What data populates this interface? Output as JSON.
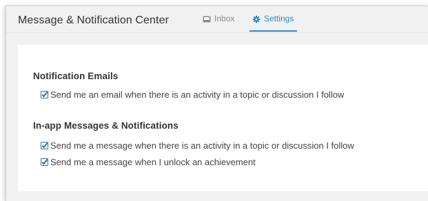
{
  "header": {
    "title": "Message & Notification Center",
    "tabs": [
      {
        "label": "Inbox",
        "icon": "inbox-icon",
        "active": false
      },
      {
        "label": "Settings",
        "icon": "gear-icon",
        "active": true
      }
    ]
  },
  "settings": {
    "sections": [
      {
        "heading": "Notification Emails",
        "options": [
          {
            "label": "Send me an email when there is an activity in a topic or discussion I follow",
            "checked": true
          }
        ]
      },
      {
        "heading": "In-app Messages & Notifications",
        "options": [
          {
            "label": "Send me a message when there is an activity in a topic or discussion I follow",
            "checked": true
          },
          {
            "label": "Send me a message when I unlock an achievement",
            "checked": true
          }
        ]
      }
    ]
  },
  "colors": {
    "accent": "#2a8cc4",
    "checkbox": "#2a6fa8",
    "window_bg": "#f1f1f1",
    "panel_bg": "#ffffff",
    "text": "#333333"
  }
}
